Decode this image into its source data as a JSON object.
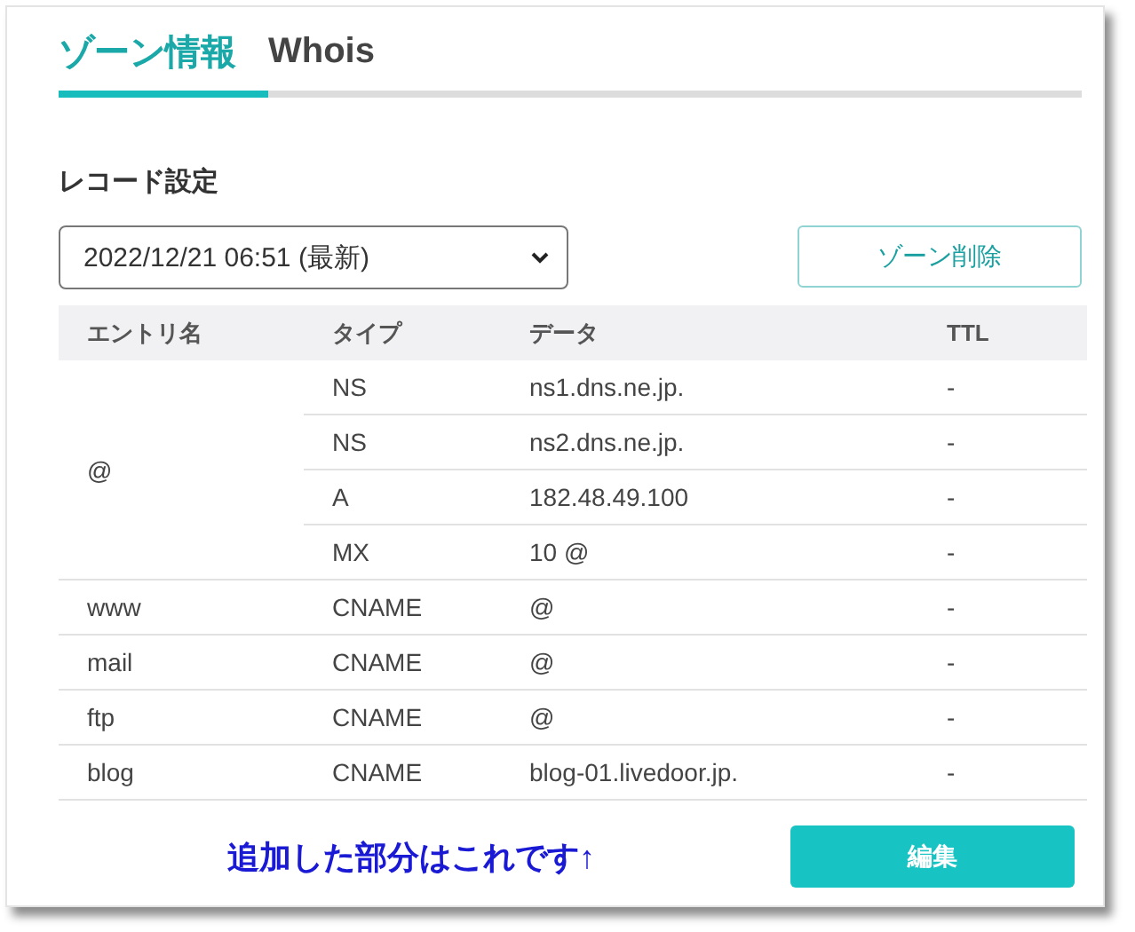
{
  "tabs": [
    {
      "label": "ゾーン情報",
      "selected": true
    },
    {
      "label": "Whois",
      "selected": false
    }
  ],
  "section_title": "レコード設定",
  "version_select": {
    "value": "2022/12/21 06:51 (最新)"
  },
  "delete_button": "ゾーン削除",
  "table": {
    "columns": [
      "エントリ名",
      "タイプ",
      "データ",
      "TTL"
    ],
    "groups": [
      {
        "entry": "@",
        "records": [
          {
            "type": "NS",
            "data": "ns1.dns.ne.jp.",
            "ttl": "-"
          },
          {
            "type": "NS",
            "data": "ns2.dns.ne.jp.",
            "ttl": "-"
          },
          {
            "type": "A",
            "data": "182.48.49.100",
            "ttl": "-"
          },
          {
            "type": "MX",
            "data": "10 @",
            "ttl": "-"
          }
        ]
      },
      {
        "entry": "www",
        "records": [
          {
            "type": "CNAME",
            "data": "@",
            "ttl": "-"
          }
        ]
      },
      {
        "entry": "mail",
        "records": [
          {
            "type": "CNAME",
            "data": "@",
            "ttl": "-"
          }
        ]
      },
      {
        "entry": "ftp",
        "records": [
          {
            "type": "CNAME",
            "data": "@",
            "ttl": "-"
          }
        ]
      },
      {
        "entry": "blog",
        "records": [
          {
            "type": "CNAME",
            "data": "blog-01.livedoor.jp.",
            "ttl": "-"
          }
        ]
      }
    ]
  },
  "annotation": "追加した部分はこれです↑",
  "edit_button": "編集"
}
